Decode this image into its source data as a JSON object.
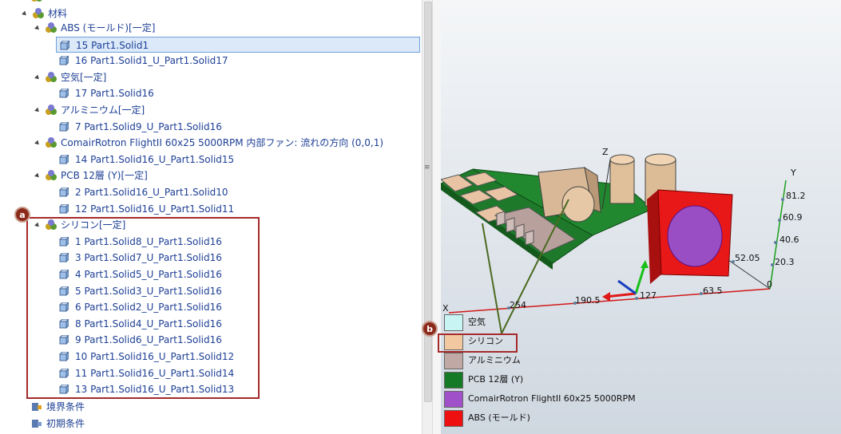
{
  "tree": {
    "root_label": "材料",
    "groups": [
      {
        "label": "ABS (モールド)[一定]",
        "items": [
          "15 Part1.Solid1",
          "16 Part1.Solid1_U_Part1.Solid17"
        ]
      },
      {
        "label": "空気[一定]",
        "items": [
          "17 Part1.Solid16"
        ]
      },
      {
        "label": "アルミニウム[一定]",
        "items": [
          "7 Part1.Solid9_U_Part1.Solid16"
        ]
      },
      {
        "label": "ComairRotron FlightII 60x25 5000RPM 内部ファン: 流れの方向 (0,0,1)",
        "items": [
          "14 Part1.Solid16_U_Part1.Solid15"
        ]
      },
      {
        "label": "PCB 12層 (Y)[一定]",
        "items": [
          "2 Part1.Solid16_U_Part1.Solid10",
          "12 Part1.Solid16_U_Part1.Solid11"
        ]
      },
      {
        "label": "シリコン[一定]",
        "items": [
          "1 Part1.Solid8_U_Part1.Solid16",
          "3 Part1.Solid7_U_Part1.Solid16",
          "4 Part1.Solid5_U_Part1.Solid16",
          "5 Part1.Solid3_U_Part1.Solid16",
          "6 Part1.Solid2_U_Part1.Solid16",
          "8 Part1.Solid4_U_Part1.Solid16",
          "9 Part1.Solid6_U_Part1.Solid16",
          "10 Part1.Solid16_U_Part1.Solid12",
          "11 Part1.Solid16_U_Part1.Solid14",
          "13 Part1.Solid16_U_Part1.Solid13"
        ]
      }
    ],
    "boundary_label": "境界条件",
    "initial_label": "初期条件",
    "selected_item": "15 Part1.Solid1"
  },
  "callouts": {
    "a": "a",
    "b": "b"
  },
  "legend": [
    {
      "label": "空気",
      "color": "#c8f4f4"
    },
    {
      "label": "シリコン",
      "color": "#f2c8a0"
    },
    {
      "label": "アルミニウム",
      "color": "#c0a8a4"
    },
    {
      "label": "PCB 12層 (Y)",
      "color": "#157a25"
    },
    {
      "label": "ComairRotron FlightII 60x25 5000RPM",
      "color": "#a050c8"
    },
    {
      "label": "ABS (モールド)",
      "color": "#ee1010"
    }
  ],
  "axes": {
    "x_label": "X",
    "y_label": "Y",
    "z_label": "Z",
    "x_ticks": [
      "254",
      "190.5",
      "127",
      "63.5",
      "0"
    ],
    "y_ticks": [
      "81.2",
      "60.9",
      "40.6",
      "20.3"
    ],
    "z_tick": "52.05"
  }
}
